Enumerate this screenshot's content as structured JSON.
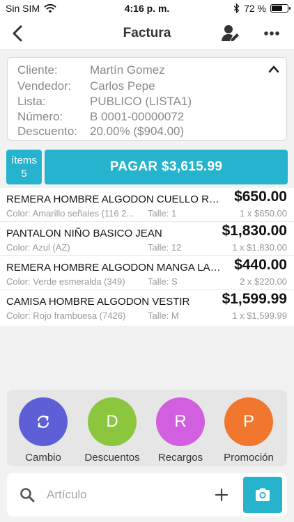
{
  "status": {
    "carrier": "Sin SIM",
    "time": "4:16 p. m.",
    "battery": "72 %",
    "battery_level": 0.72
  },
  "nav": {
    "title": "Factura"
  },
  "client": {
    "rows": [
      {
        "label": "Cliente:",
        "value": "Martín Gomez"
      },
      {
        "label": "Vendedor:",
        "value": "Carlos Pepe"
      },
      {
        "label": "Lista:",
        "value": "PUBLICO (LISTA1)"
      },
      {
        "label": "Número:",
        "value": "B 0001-00000072"
      },
      {
        "label": "Descuento:",
        "value": "20.00% ($904.00)"
      }
    ]
  },
  "summary": {
    "items_label": "ítems",
    "items_count": "5",
    "pay_label": "PAGAR $3,615.99"
  },
  "items": [
    {
      "name": "REMERA HOMBRE ALGODON CUELLO REDONDO",
      "color": "Color: Amarillo señales (116 2...",
      "size": "Talle: 1",
      "price": "$650.00",
      "unit": "1 x $650.00"
    },
    {
      "name": "PANTALON NIÑO BASICO JEAN",
      "color": "Color: Azul (AZ)",
      "size": "Talle: 12",
      "price": "$1,830.00",
      "unit": "1 x $1,830.00"
    },
    {
      "name": "REMERA HOMBRE ALGODON MANGA LARGA",
      "color": "Color: Verde esmeralda (349)",
      "size": "Talle: S",
      "price": "$440.00",
      "unit": "2 x $220.00"
    },
    {
      "name": "CAMISA HOMBRE ALGODON VESTIR",
      "color": "Color: Rojo frambuesa (7426)",
      "size": "Talle: M",
      "price": "$1,599.99",
      "unit": "1 x $1,599.99"
    }
  ],
  "actions": [
    {
      "label": "Cambio",
      "icon": "refresh-icon",
      "letter": "",
      "color": "#5c5fd6"
    },
    {
      "label": "Descuentos",
      "icon": "",
      "letter": "D",
      "color": "#8cc63f"
    },
    {
      "label": "Recargos",
      "icon": "",
      "letter": "R",
      "color": "#d15fdf"
    },
    {
      "label": "Promoción",
      "icon": "",
      "letter": "P",
      "color": "#f0772d"
    }
  ],
  "search": {
    "placeholder": "Artículo"
  },
  "colors": {
    "accent": "#26b3cd"
  }
}
